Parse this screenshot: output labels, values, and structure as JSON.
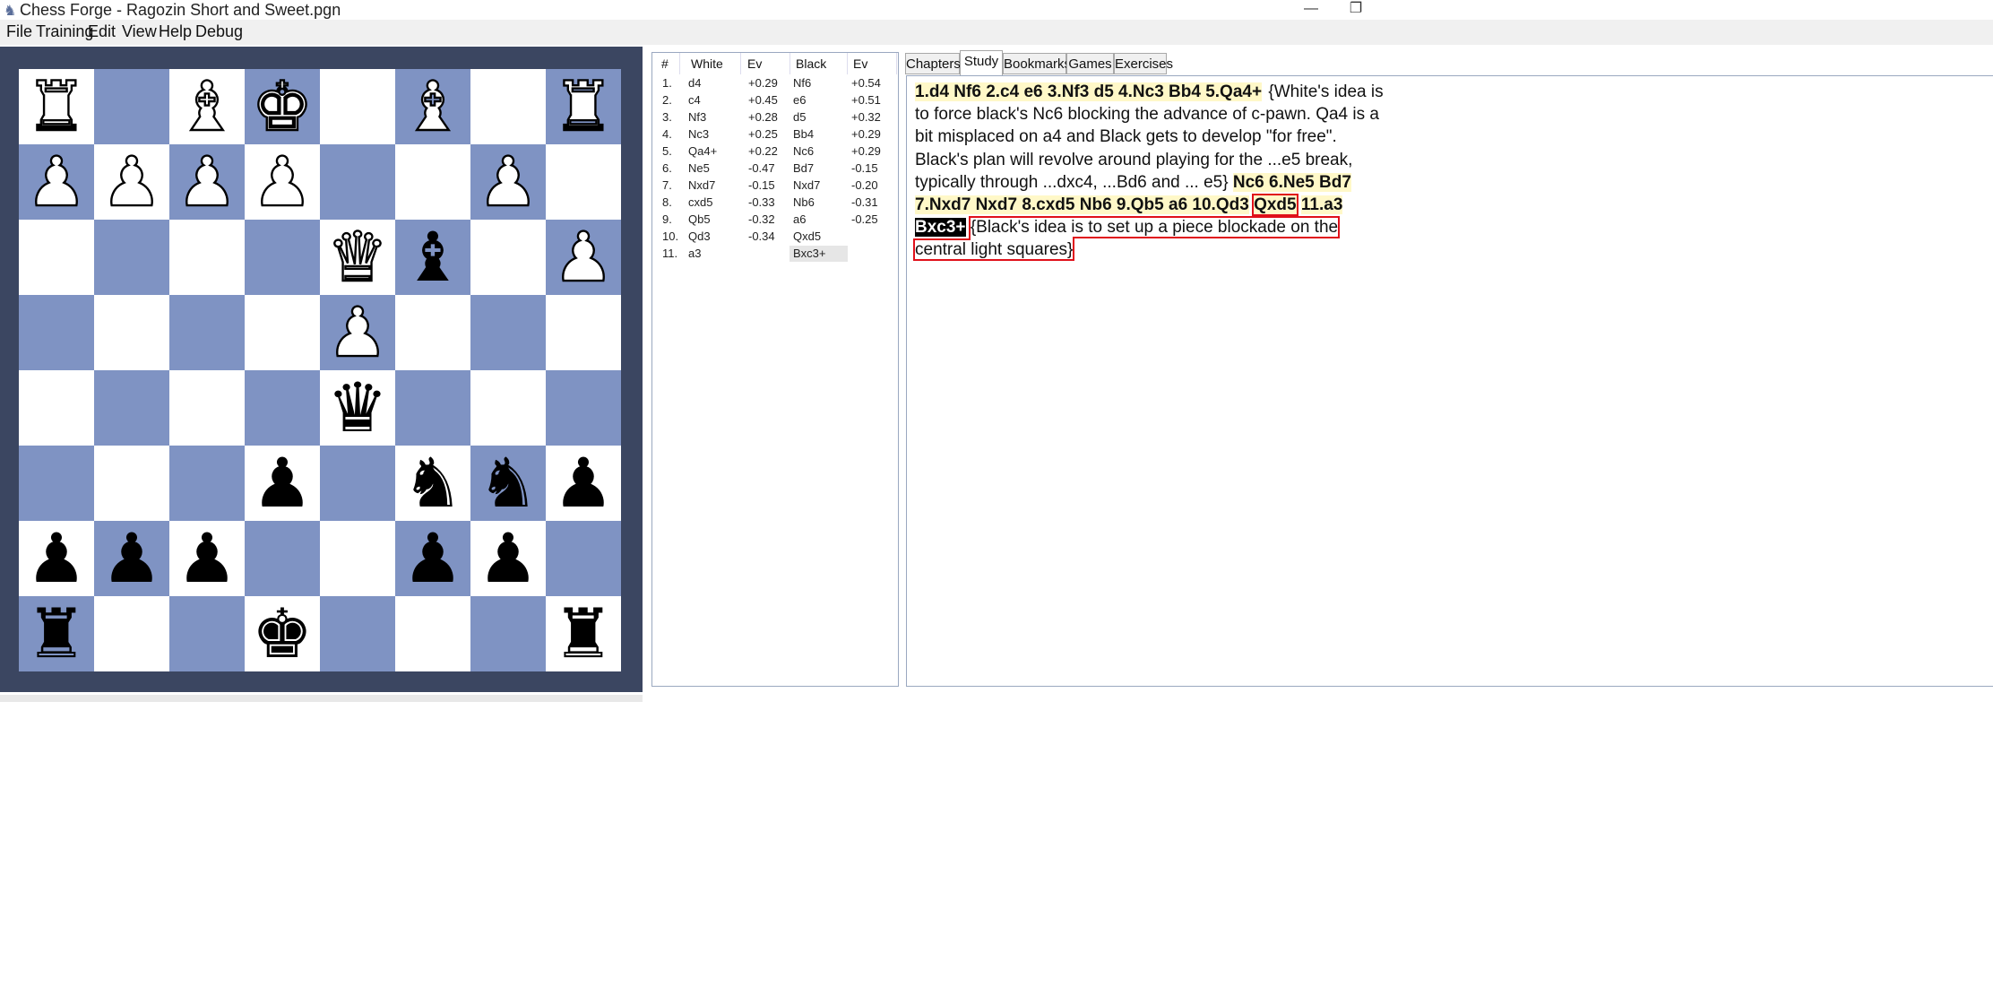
{
  "window": {
    "title": "Chess Forge - Ragozin Short and Sweet.pgn",
    "icon": "knight-icon"
  },
  "menu": [
    "File",
    "Training",
    "Edit",
    "View",
    "Help",
    "Debug"
  ],
  "colors": {
    "light_square": "#ffffff",
    "dark_square": "#7f93c3",
    "frame": "#3b4661",
    "move_bg": "#fff8c8",
    "highlight": "#e0101a"
  },
  "board": {
    "squares": [
      "R",
      "",
      "B",
      "K",
      "",
      "B",
      "",
      "R",
      "P",
      "P",
      "P",
      "P",
      "",
      "",
      "P",
      "",
      "",
      "",
      "",
      "",
      "Q",
      "b",
      "",
      "P",
      "",
      "",
      "",
      "",
      "P",
      "",
      "",
      "",
      "",
      "",
      "",
      "",
      "q",
      "",
      "",
      "",
      "",
      "",
      "",
      "p",
      "",
      "n",
      "n",
      "p",
      "p",
      "p",
      "p",
      "",
      "",
      "p",
      "p",
      "",
      "r",
      "",
      "",
      "k",
      "",
      "",
      "",
      "r"
    ]
  },
  "move_table": {
    "headers": [
      "#",
      "White",
      "Ev",
      "Black",
      "Ev"
    ],
    "rows": [
      {
        "num": "1.",
        "white": "d4",
        "wev": "+0.29",
        "black": "Nf6",
        "bev": "+0.54"
      },
      {
        "num": "2.",
        "white": "c4",
        "wev": "+0.45",
        "black": "e6",
        "bev": "+0.51"
      },
      {
        "num": "3.",
        "white": "Nf3",
        "wev": "+0.28",
        "black": "d5",
        "bev": "+0.32"
      },
      {
        "num": "4.",
        "white": "Nc3",
        "wev": "+0.25",
        "black": "Bb4",
        "bev": "+0.29"
      },
      {
        "num": "5.",
        "white": "Qa4+",
        "wev": "+0.22",
        "black": "Nc6",
        "bev": "+0.29"
      },
      {
        "num": "6.",
        "white": "Ne5",
        "wev": "-0.47",
        "black": "Bd7",
        "bev": "-0.15"
      },
      {
        "num": "7.",
        "white": "Nxd7",
        "wev": "-0.15",
        "black": "Nxd7",
        "bev": "-0.20"
      },
      {
        "num": "8.",
        "white": "cxd5",
        "wev": "-0.33",
        "black": "Nb6",
        "bev": "-0.31"
      },
      {
        "num": "9.",
        "white": "Qb5",
        "wev": "-0.32",
        "black": "a6",
        "bev": "-0.25"
      },
      {
        "num": "10.",
        "white": "Qd3",
        "wev": "-0.34",
        "black": "Qxd5",
        "bev": ""
      },
      {
        "num": "11.",
        "white": "a3",
        "wev": "",
        "black": "Bxc3+",
        "bev": ""
      }
    ]
  },
  "tabs": [
    "Chapters",
    "Study",
    "Bookmarks",
    "Games",
    "Exercises"
  ],
  "study": {
    "moves1": "1.d4 Nf6 2.c4 e6 3.Nf3 d5 4.Nc3 Bb4 5.Qa4+",
    "comment1": "{White's idea is to  force black's Nc6 blocking the advance of c-pawn. Qa4 is a bit misplaced on a4  and Black gets to develop \"for free\". Black's plan will revolve around playing  for the ...e5 break, typically through ...dxc4, ...Bd6 and ... e5}",
    "moves2": "Nc6 6.Ne5 Bd7 7.Nxd7 Nxd7 8.cxd5 Nb6 9.Qb5 a6 10.Qd3",
    "move_qxd5": "Qxd5",
    "move_a3": "11.a3",
    "move_current": "Bxc3+",
    "comment2": "{Black's idea is to set up a piece blockade on the central light squares}"
  }
}
